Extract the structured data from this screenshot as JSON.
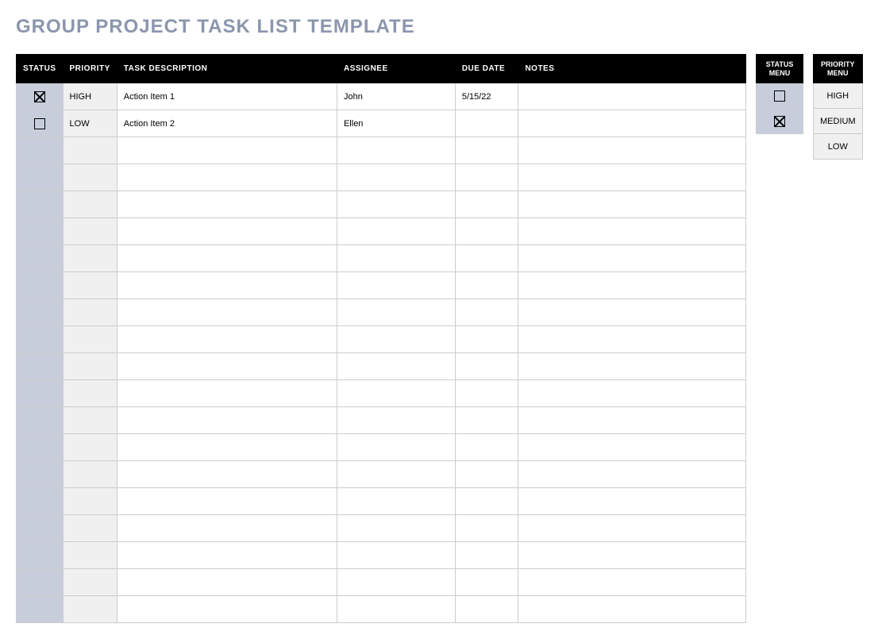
{
  "title": "GROUP PROJECT TASK LIST TEMPLATE",
  "table": {
    "headers": {
      "status": "STATUS",
      "priority": "PRIORITY",
      "task": "TASK DESCRIPTION",
      "assignee": "ASSIGNEE",
      "due": "DUE DATE",
      "notes": "NOTES"
    },
    "rows": [
      {
        "status_checked": true,
        "priority": "HIGH",
        "task": "Action Item 1",
        "assignee": "John",
        "due": "5/15/22",
        "notes": ""
      },
      {
        "status_checked": false,
        "priority": "LOW",
        "task": "Action Item 2",
        "assignee": "Ellen",
        "due": "",
        "notes": ""
      },
      {
        "status_checked": null,
        "priority": "",
        "task": "",
        "assignee": "",
        "due": "",
        "notes": ""
      },
      {
        "status_checked": null,
        "priority": "",
        "task": "",
        "assignee": "",
        "due": "",
        "notes": ""
      },
      {
        "status_checked": null,
        "priority": "",
        "task": "",
        "assignee": "",
        "due": "",
        "notes": ""
      },
      {
        "status_checked": null,
        "priority": "",
        "task": "",
        "assignee": "",
        "due": "",
        "notes": ""
      },
      {
        "status_checked": null,
        "priority": "",
        "task": "",
        "assignee": "",
        "due": "",
        "notes": ""
      },
      {
        "status_checked": null,
        "priority": "",
        "task": "",
        "assignee": "",
        "due": "",
        "notes": ""
      },
      {
        "status_checked": null,
        "priority": "",
        "task": "",
        "assignee": "",
        "due": "",
        "notes": ""
      },
      {
        "status_checked": null,
        "priority": "",
        "task": "",
        "assignee": "",
        "due": "",
        "notes": ""
      },
      {
        "status_checked": null,
        "priority": "",
        "task": "",
        "assignee": "",
        "due": "",
        "notes": ""
      },
      {
        "status_checked": null,
        "priority": "",
        "task": "",
        "assignee": "",
        "due": "",
        "notes": ""
      },
      {
        "status_checked": null,
        "priority": "",
        "task": "",
        "assignee": "",
        "due": "",
        "notes": ""
      },
      {
        "status_checked": null,
        "priority": "",
        "task": "",
        "assignee": "",
        "due": "",
        "notes": ""
      },
      {
        "status_checked": null,
        "priority": "",
        "task": "",
        "assignee": "",
        "due": "",
        "notes": ""
      },
      {
        "status_checked": null,
        "priority": "",
        "task": "",
        "assignee": "",
        "due": "",
        "notes": ""
      },
      {
        "status_checked": null,
        "priority": "",
        "task": "",
        "assignee": "",
        "due": "",
        "notes": ""
      },
      {
        "status_checked": null,
        "priority": "",
        "task": "",
        "assignee": "",
        "due": "",
        "notes": ""
      },
      {
        "status_checked": null,
        "priority": "",
        "task": "",
        "assignee": "",
        "due": "",
        "notes": ""
      },
      {
        "status_checked": null,
        "priority": "",
        "task": "",
        "assignee": "",
        "due": "",
        "notes": ""
      }
    ]
  },
  "status_menu": {
    "header": "STATUS MENU",
    "items": [
      {
        "checked": false
      },
      {
        "checked": true
      }
    ]
  },
  "priority_menu": {
    "header": "PRIORITY MENU",
    "items": [
      "HIGH",
      "MEDIUM",
      "LOW"
    ]
  }
}
